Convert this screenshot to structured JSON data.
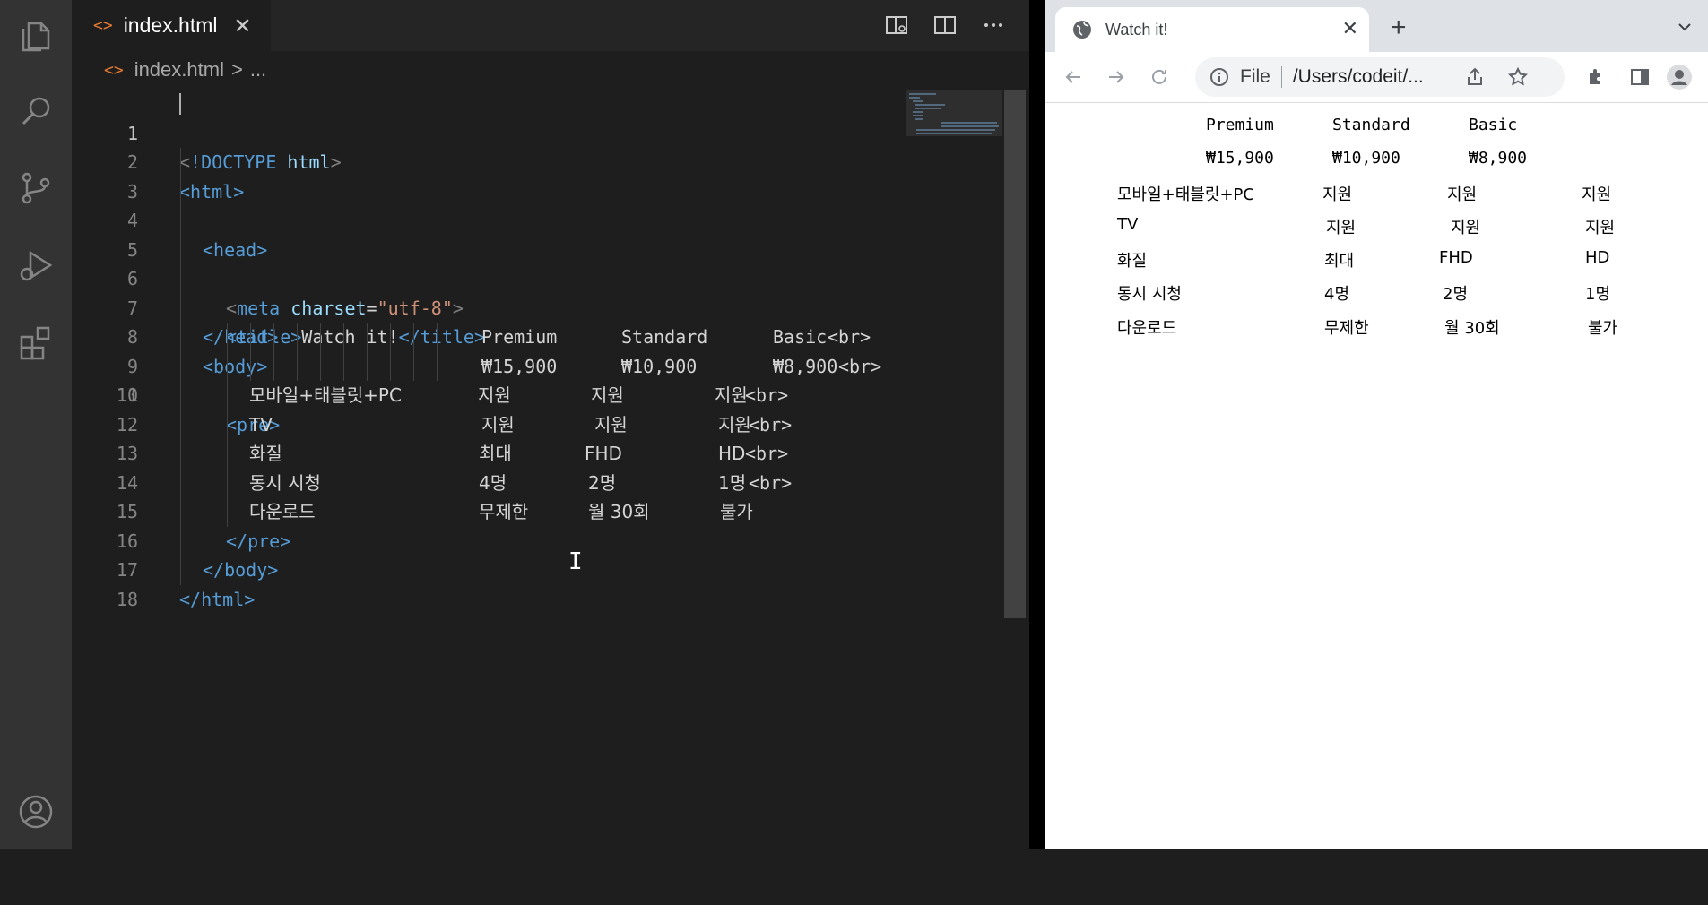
{
  "editor": {
    "tab": {
      "icon": "html-file-icon",
      "label": "index.html",
      "close": "✕"
    },
    "breadcrumb": {
      "file": "index.html",
      "sep": ">",
      "rest": "..."
    },
    "code_lines": [
      {
        "n": "1"
      },
      {
        "n": "2"
      },
      {
        "n": "3"
      },
      {
        "n": "4"
      },
      {
        "n": "5"
      },
      {
        "n": "6"
      },
      {
        "n": "7"
      },
      {
        "n": "8"
      },
      {
        "n": "9"
      },
      {
        "n": "10"
      },
      {
        "n": "11"
      },
      {
        "n": "12"
      },
      {
        "n": "13"
      },
      {
        "n": "14"
      },
      {
        "n": "15"
      },
      {
        "n": "16"
      },
      {
        "n": "17"
      },
      {
        "n": "18"
      }
    ],
    "code": {
      "doctype_lt": "<",
      "doctype_bang": "!DOCTYPE",
      "doctype_html": " html",
      "doctype_gt": ">",
      "html_open": "<html>",
      "head_open": "<head>",
      "meta_lt": "<",
      "meta_tag": "meta",
      "meta_attr": " charset",
      "meta_eq": "=",
      "meta_val": "\"utf-8\"",
      "meta_gt": ">",
      "title_open": "<title>",
      "title_text": "Watch it!",
      "title_close": "</title>",
      "head_close": "</head>",
      "body_open": "<body>",
      "pre_open": "<pre>",
      "br": "<br>",
      "pre_close": "</pre>",
      "body_close": "</body>",
      "html_close": "</html>"
    },
    "table": {
      "plans": [
        "Premium",
        "Standard",
        "Basic"
      ],
      "prices": [
        "₩15,900",
        "₩10,900",
        "₩8,900"
      ],
      "rows": [
        {
          "label": "모바일+태블릿+PC",
          "values": [
            "지원",
            "지원",
            "지원"
          ]
        },
        {
          "label": "TV",
          "values": [
            "지원",
            "지원",
            "지원"
          ]
        },
        {
          "label": "화질",
          "values": [
            "최대",
            "FHD",
            "HD"
          ]
        },
        {
          "label": "동시 시청",
          "values": [
            "4명",
            "2명",
            "1명"
          ]
        },
        {
          "label": "다운로드",
          "values": [
            "무제한",
            "월 30회",
            "불가"
          ]
        }
      ]
    }
  },
  "browser": {
    "tab_title": "Watch it!",
    "tab_close": "✕",
    "new_tab": "+",
    "tab_search": "⌄",
    "omnibox": {
      "scheme": "File",
      "url": "/Users/codeit/..."
    },
    "content": {
      "plans": [
        "Premium",
        "Standard",
        "Basic"
      ],
      "prices": [
        "₩15,900",
        "₩10,900",
        "₩8,900"
      ],
      "rows": [
        {
          "label": "모바일+태블릿+PC",
          "values": [
            "지원",
            "지원",
            "지원"
          ]
        },
        {
          "label": "TV",
          "values": [
            "지원",
            "지원",
            "지원"
          ]
        },
        {
          "label": "화질",
          "values": [
            "최대",
            "FHD",
            "HD"
          ]
        },
        {
          "label": "동시 시청",
          "values": [
            "4명",
            "2명",
            "1명"
          ]
        },
        {
          "label": "다운로드",
          "values": [
            "무제한",
            "월 30회",
            "불가"
          ]
        }
      ]
    }
  },
  "colors": {
    "editor_bg": "#1e1e1e",
    "activity_bg": "#333333",
    "tag": "#569cd6",
    "string": "#ce9178",
    "attr": "#9cdcfe",
    "file_icon": "#e37933"
  }
}
